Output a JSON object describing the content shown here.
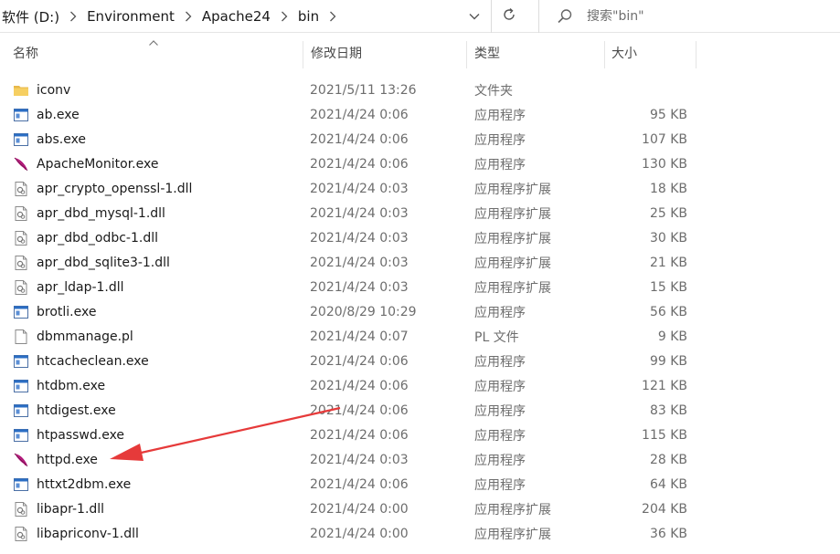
{
  "breadcrumb": [
    "软件 (D:)",
    "Environment",
    "Apache24",
    "bin"
  ],
  "search": {
    "placeholder": "搜索\"bin\""
  },
  "columns": {
    "name": "名称",
    "date": "修改日期",
    "type": "类型",
    "size": "大小"
  },
  "icons": {
    "breadcrumb_separator": "chevron-right-icon",
    "history": "chevron-down-icon",
    "refresh": "refresh-icon",
    "search": "search-icon",
    "sort": "sort-ascending-icon"
  },
  "colors": {
    "folder": "#e8b84b",
    "exe": "#2b6ec4",
    "annotation_arrow": "#e63a3a"
  },
  "files": [
    {
      "name": "iconv",
      "date": "2021/5/11 13:26",
      "type": "文件夹",
      "size": "",
      "icon": "folder-icon"
    },
    {
      "name": "ab.exe",
      "date": "2021/4/24 0:06",
      "type": "应用程序",
      "size": "95 KB",
      "icon": "exe-icon"
    },
    {
      "name": "abs.exe",
      "date": "2021/4/24 0:06",
      "type": "应用程序",
      "size": "107 KB",
      "icon": "exe-icon"
    },
    {
      "name": "ApacheMonitor.exe",
      "date": "2021/4/24 0:06",
      "type": "应用程序",
      "size": "130 KB",
      "icon": "apache-feather-icon"
    },
    {
      "name": "apr_crypto_openssl-1.dll",
      "date": "2021/4/24 0:03",
      "type": "应用程序扩展",
      "size": "18 KB",
      "icon": "dll-icon"
    },
    {
      "name": "apr_dbd_mysql-1.dll",
      "date": "2021/4/24 0:03",
      "type": "应用程序扩展",
      "size": "25 KB",
      "icon": "dll-icon"
    },
    {
      "name": "apr_dbd_odbc-1.dll",
      "date": "2021/4/24 0:03",
      "type": "应用程序扩展",
      "size": "30 KB",
      "icon": "dll-icon"
    },
    {
      "name": "apr_dbd_sqlite3-1.dll",
      "date": "2021/4/24 0:03",
      "type": "应用程序扩展",
      "size": "21 KB",
      "icon": "dll-icon"
    },
    {
      "name": "apr_ldap-1.dll",
      "date": "2021/4/24 0:03",
      "type": "应用程序扩展",
      "size": "15 KB",
      "icon": "dll-icon"
    },
    {
      "name": "brotli.exe",
      "date": "2020/8/29 10:29",
      "type": "应用程序",
      "size": "56 KB",
      "icon": "exe-icon"
    },
    {
      "name": "dbmmanage.pl",
      "date": "2021/4/24 0:07",
      "type": "PL 文件",
      "size": "9 KB",
      "icon": "file-icon"
    },
    {
      "name": "htcacheclean.exe",
      "date": "2021/4/24 0:06",
      "type": "应用程序",
      "size": "99 KB",
      "icon": "exe-icon"
    },
    {
      "name": "htdbm.exe",
      "date": "2021/4/24 0:06",
      "type": "应用程序",
      "size": "121 KB",
      "icon": "exe-icon"
    },
    {
      "name": "htdigest.exe",
      "date": "2021/4/24 0:06",
      "type": "应用程序",
      "size": "83 KB",
      "icon": "exe-icon"
    },
    {
      "name": "htpasswd.exe",
      "date": "2021/4/24 0:06",
      "type": "应用程序",
      "size": "115 KB",
      "icon": "exe-icon"
    },
    {
      "name": "httpd.exe",
      "date": "2021/4/24 0:03",
      "type": "应用程序",
      "size": "28 KB",
      "icon": "apache-feather-icon"
    },
    {
      "name": "httxt2dbm.exe",
      "date": "2021/4/24 0:06",
      "type": "应用程序",
      "size": "64 KB",
      "icon": "exe-icon"
    },
    {
      "name": "libapr-1.dll",
      "date": "2021/4/24 0:00",
      "type": "应用程序扩展",
      "size": "204 KB",
      "icon": "dll-icon"
    },
    {
      "name": "libapriconv-1.dll",
      "date": "2021/4/24 0:00",
      "type": "应用程序扩展",
      "size": "36 KB",
      "icon": "dll-icon"
    }
  ]
}
